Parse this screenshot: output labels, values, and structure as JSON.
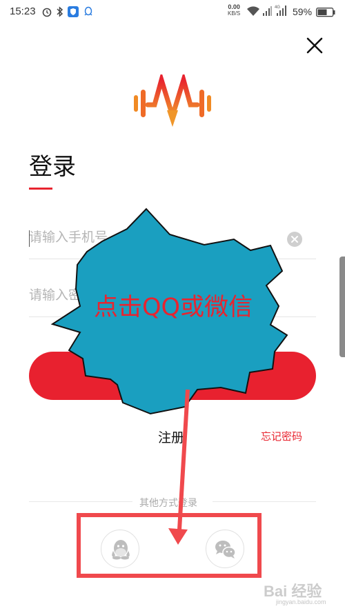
{
  "status_bar": {
    "time": "15:23",
    "net_speed_value": "0.00",
    "net_speed_unit": "KB/S",
    "battery_percent": "59%",
    "icons": [
      "alarm-icon",
      "bluetooth-icon",
      "shield-app-icon",
      "qq-notification-icon",
      "wifi-icon",
      "signal-icon",
      "4g-signal-icon",
      "battery-icon"
    ]
  },
  "header": {
    "close_icon": "close-icon",
    "logo_icon": "music-wave-logo",
    "title": "登录"
  },
  "form": {
    "phone_placeholder": "请输入手机号",
    "password_placeholder": "请输入密码",
    "clear_icon": "clear-icon",
    "login_button_label": ""
  },
  "links": {
    "register": "注册",
    "forgot_password": "忘记密码"
  },
  "other_login": {
    "label": "其他方式登录",
    "options": [
      {
        "name": "QQ",
        "icon": "qq-icon"
      },
      {
        "name": "WeChat",
        "icon": "wechat-icon"
      }
    ]
  },
  "annotation": {
    "callout_text": "点击QQ或微信",
    "callout_fill": "#1a9fc0",
    "highlight_color": "#f0494d"
  },
  "watermark": {
    "text": "Bai 经验",
    "sub": "jingyan.baidu.com"
  },
  "colors": {
    "accent": "#e8242f",
    "logo_gradient": [
      "#f08a24",
      "#e8242f"
    ]
  }
}
